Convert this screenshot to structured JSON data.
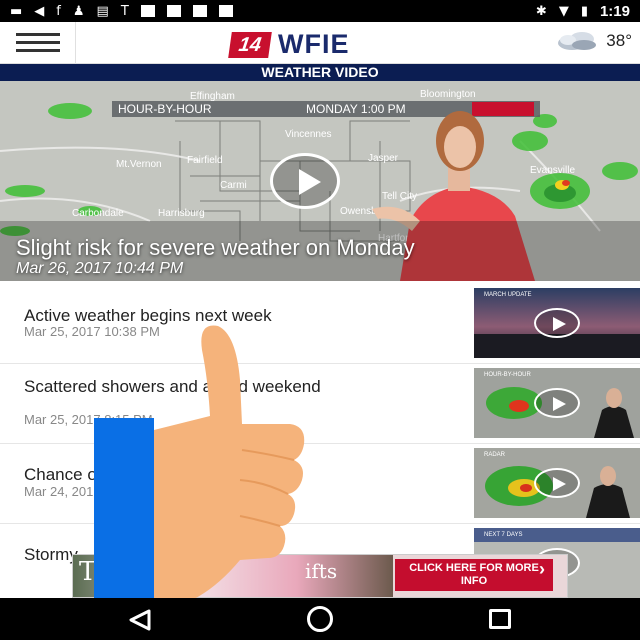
{
  "status_bar": {
    "time": "1:19",
    "left_icons": [
      "message-icon",
      "navigation-icon",
      "facebook-icon",
      "bulb-icon",
      "cast-icon",
      "t-icon",
      "box-icon",
      "box-icon",
      "box-icon",
      "box-icon"
    ],
    "right_icons": [
      "bluetooth-icon",
      "wifi-icon",
      "battery-icon"
    ],
    "t_glyph": "T",
    "f_glyph": "f"
  },
  "header": {
    "logo_number": "14",
    "logo_text": "WFIE",
    "temperature": "38°",
    "weather_icon": "cloud-icon"
  },
  "section_title": "WEATHER VIDEO",
  "hero": {
    "headline": "Slight risk for severe weather on Monday",
    "date": "Mar 26, 2017 10:44 PM",
    "overlay_left": "HOUR-BY-HOUR",
    "overlay_right": "MONDAY 1:00 PM",
    "city_labels": [
      "Effingham",
      "Bloomington",
      "Vincennes",
      "Fairfield",
      "Jasper",
      "Mt.Vernon",
      "Carmi",
      "Owensboro",
      "Carbondale",
      "Harrisburg",
      "Hartford",
      "Tell City",
      "Evansville"
    ]
  },
  "list": [
    {
      "title": "Active weather begins next week",
      "date": "Mar 25, 2017 10:38 PM",
      "thumb_caption": "MARCH UPDATE"
    },
    {
      "title": "Scattered showers and a mild weekend",
      "date": "Mar 25, 2017 8:15 PM",
      "thumb_caption": "HOUR-BY-HOUR"
    },
    {
      "title": "Chance of rain this weekend",
      "date": "Mar 24, 2017 5:53 PM",
      "thumb_caption": "RADAR"
    },
    {
      "title": "Stormy",
      "date": "",
      "thumb_caption": "NEXT 7 DAYS"
    }
  ],
  "ad": {
    "left_text": "T",
    "right_text": "ifts",
    "cta": "CLICK HERE FOR MORE INFO",
    "cta_chevron": "›"
  },
  "colors": {
    "brand_navy": "#0b1d52",
    "brand_red": "#c8102e",
    "thumb_blue": "#0a6fe5",
    "thumb_skin": "#f5b37b"
  },
  "nav": {
    "back_icon": "back-icon",
    "home_icon": "home-icon",
    "recents_icon": "recents-icon"
  }
}
